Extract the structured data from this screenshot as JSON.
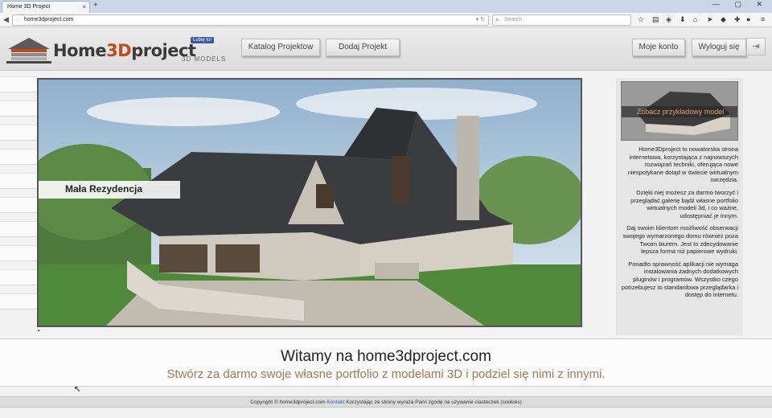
{
  "browser": {
    "tab_title": "Home 3D Project",
    "tab_close": "×",
    "new_tab": "+",
    "window_controls": "— ▢ ✕",
    "url": "home3dproject.com",
    "search_placeholder": "Search",
    "icons": [
      "back-icon",
      "globe-icon",
      "reload-icon",
      "star-icon",
      "reading-list-icon",
      "download-icon",
      "home-icon",
      "send-icon",
      "pocket-icon",
      "extensions-icon",
      "chat-icon",
      "menu-icon"
    ]
  },
  "header": {
    "brand_main": "Home",
    "brand_3d": "3D",
    "brand_rest": "project",
    "brand_sub": "3D MODELS",
    "fb_like": "Lubię to!",
    "nav": {
      "catalog": "Katalog Projektow",
      "add": "Dodaj Projekt",
      "account": "Moje konto",
      "logout": "Wyloguj się"
    }
  },
  "viewer": {
    "project_name": "Mała Rezydencja"
  },
  "sidebar": {
    "preview_caption": "Zobacz przykładowy model",
    "paragraphs": [
      "Home3Dproject to nowatorska strona internetowa, korzystająca z najnowszych rozwiązań techniki, oferująca nowe niespotykane dotąd w świecie wirtualnym narzędzia.",
      "Dzięki niej możesz za darmo tworzyć i przeglądać galerię bądź własne portfolio wirtualnych modeli 3d, i co ważne, udostępniać je innym.",
      "Daj swoim klientom możliwość obserwacji swojego wymarzonego domu również poza Twoim biurem. Jest to zdecydowanie lepsza forma niż papierowe wydruki.",
      "Ponadto sprawność aplikacji nie wymaga instalowania żadnych dodatkowych pluginów i programów. Wszystko czego potrzebujesz to standardowa przeglądarka i dostęp do internetu."
    ]
  },
  "welcome": {
    "title": "Witamy na home3dproject.com",
    "subtitle": "Stwórz za darmo swoje własne portfolio z modelami 3D i podziel się nimi z innymi."
  },
  "footer": {
    "copyright": "Copyright © home3dproject.com",
    "contact_link": "Kontakt",
    "cookies": "Korzystając ze strony wyraża Pan/i zgodę na używanie ciasteczek (cookies)"
  },
  "colors": {
    "brand_accent": "#c44a1b",
    "subtitle": "#a17a52",
    "link": "#2a62b5"
  }
}
